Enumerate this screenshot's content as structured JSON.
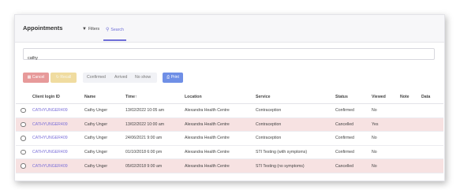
{
  "header": {
    "title": "Appointments",
    "tabs": [
      {
        "label": "Filters",
        "icon": "filter-icon"
      },
      {
        "label": "Search",
        "icon": "search-icon"
      }
    ]
  },
  "search": {
    "value": "cathy"
  },
  "toolbar": {
    "cancel_label": "Cancel",
    "recall_label": "Recall",
    "status_options": [
      "Confirmed",
      "Arrived",
      "No show"
    ],
    "print_label": "Print"
  },
  "table": {
    "columns": [
      "",
      "Client login ID",
      "Name",
      "Time",
      "Location",
      "Service",
      "Status",
      "Viewed",
      "Note",
      "Data"
    ],
    "time_sort_indicator": "↑",
    "rows": [
      {
        "id": "CATHYUNGER409",
        "name": "Cathy Unger",
        "time": "13/02/2022 10:05 am",
        "location": "Alexandra Health Centre",
        "service": "Contraception",
        "status": "Confirmed",
        "viewed": "No",
        "note": "",
        "data": ""
      },
      {
        "id": "CATHYUNGER409",
        "name": "Cathy Unger",
        "time": "13/02/2022 10:00 am",
        "location": "Alexandra Health Centre",
        "service": "Contraception",
        "status": "Cancelled",
        "viewed": "Yes",
        "note": "",
        "data": ""
      },
      {
        "id": "CATHYUNGER409",
        "name": "Cathy Unger",
        "time": "24/06/2021 9:00 am",
        "location": "Alexandra Health Centre",
        "service": "Contraception",
        "status": "Confirmed",
        "viewed": "No",
        "note": "",
        "data": ""
      },
      {
        "id": "CATHYUNGER409",
        "name": "Cathy Unger",
        "time": "01/10/2018 6:00 pm",
        "location": "Alexandra Health Centre",
        "service": "STI Testing (with symptoms)",
        "status": "Confirmed",
        "viewed": "No",
        "note": "",
        "data": ""
      },
      {
        "id": "CATHYUNGER409",
        "name": "Cathy Unger",
        "time": "05/02/2018 9:00 am",
        "location": "Alexandra Health Centre",
        "service": "STI Testing (no symptoms)",
        "status": "Cancelled",
        "viewed": "No",
        "note": "",
        "data": ""
      }
    ]
  },
  "colors": {
    "accent": "#6f6fd8",
    "cancel": "#e79a9a",
    "recall": "#f0dca0",
    "print": "#6f8fe6",
    "cancelled_row": "#f7e2e2"
  }
}
